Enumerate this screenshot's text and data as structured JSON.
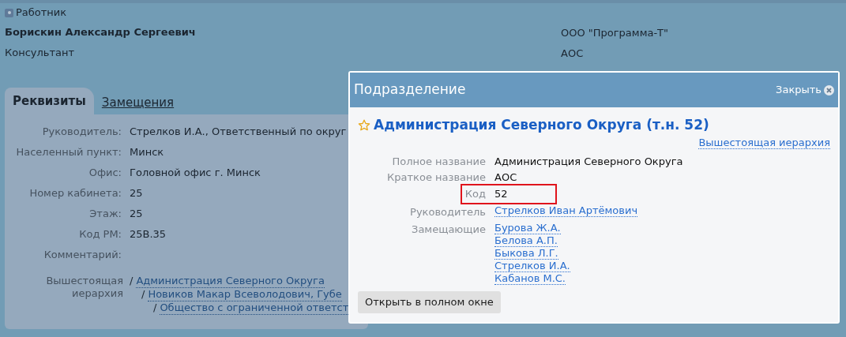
{
  "header": {
    "type_label": "Работник",
    "name": "Борискин Александр Сергеевич",
    "position": "Консультант",
    "right_lines": [
      "ООО \"Программа-Т\"",
      "АОС"
    ]
  },
  "tabs": [
    {
      "label": "Реквизиты",
      "selected": true
    },
    {
      "label": "Замещения",
      "selected": false
    }
  ],
  "details": [
    {
      "label": "Руководитель:",
      "value": "Стрелков И.А., Ответственный по округ"
    },
    {
      "label": "Населенный пункт:",
      "value": "Минск"
    },
    {
      "label": "Офис:",
      "value": "Головной офис г. Минск"
    },
    {
      "label": "Номер кабинета:",
      "value": "25"
    },
    {
      "label": "Этаж:",
      "value": "25"
    },
    {
      "label": "Код РМ:",
      "value": "25В.35"
    },
    {
      "label": "Комментарий:"
    }
  ],
  "hierarchy": {
    "label": "Вышестоящая иерархия",
    "separator": "/",
    "links": [
      "Администрация Северного Округа",
      "Новиков Макар Всеволодович, Губе",
      "Общество с ограниченной ответст"
    ]
  },
  "dialog": {
    "title": "Подразделение",
    "close_label": "Закрыть",
    "heading": "Администрация Северного Округа (т.н. 52)",
    "favorite": false,
    "hierarchy_link": "Вышестоящая иерархия",
    "fields": [
      {
        "label": "Полное название",
        "kind": "text",
        "values": [
          "Администрация Северного Округа"
        ],
        "highlighted": false
      },
      {
        "label": "Краткое название",
        "kind": "text",
        "values": [
          "АОС"
        ],
        "highlighted": false
      },
      {
        "label": "Код",
        "kind": "text",
        "values": [
          "52"
        ],
        "highlighted": true
      },
      {
        "label": "Руководитель",
        "kind": "links",
        "values": [
          "Стрелков Иван Артёмович"
        ],
        "highlighted": false
      },
      {
        "label": "Замещающие",
        "kind": "links",
        "values": [
          "Бурова Ж.А.",
          "Белова А.П.",
          "Быкова Л.Г.",
          "Стрелков И.А.",
          "Кабанов М.С."
        ],
        "highlighted": false
      }
    ],
    "button": "Открыть в полном окне"
  }
}
